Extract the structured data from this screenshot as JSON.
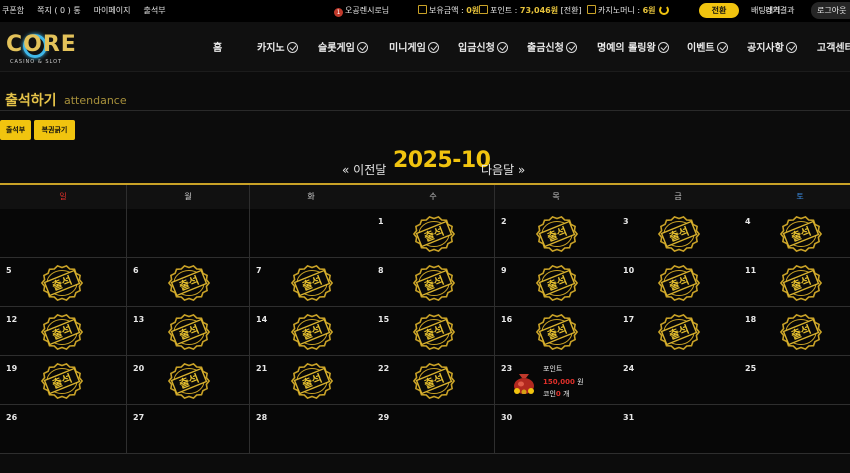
{
  "topbar": {
    "links": [
      "쿠폰함",
      "쪽지 ( 0 ) 통",
      "마이페이지",
      "출석부"
    ],
    "user_name": "오공렌시로님",
    "balance_label": "보유금액 :",
    "balance_value": "0원",
    "point_label": "포인트 :",
    "point_value": "73,046원",
    "point_action": "[전환]",
    "coin_label": "카지노머니 :",
    "coin_value": "6원",
    "exchange_label": "전환",
    "betting_history": "배팅내역",
    "match_results": "경기결과",
    "logout_label": "로그아웃"
  },
  "logo": {
    "text": "CORE",
    "subtitle": "CASINO & SLOT"
  },
  "nav": [
    "홈",
    "카지노",
    "슬롯게임",
    "미니게임",
    "입금신청",
    "출금신청",
    "명예의 롤링왕",
    "이벤트",
    "공지사항",
    "고객센터"
  ],
  "page": {
    "title": "출석하기",
    "subtitle": "attendance",
    "buttons": [
      "출석부",
      "복권긁기"
    ]
  },
  "month_nav": {
    "prev": "« 이전달",
    "current": "2025-10",
    "next": "다음달 »"
  },
  "calendar": {
    "weekdays": [
      "일",
      "월",
      "화",
      "수",
      "목",
      "금",
      "토"
    ],
    "weekday_colors": {
      "sunday": "#e0302a",
      "saturday": "#3a8ee6",
      "default": "#cfcfcf"
    },
    "stamp_text": "출석",
    "weeks": [
      [
        null,
        null,
        null,
        {
          "day": "1",
          "attended": true
        },
        {
          "day": "2",
          "attended": true
        },
        {
          "day": "3",
          "attended": true
        },
        {
          "day": "4",
          "attended": true
        }
      ],
      [
        {
          "day": "5",
          "attended": true
        },
        {
          "day": "6",
          "attended": true
        },
        {
          "day": "7",
          "attended": true
        },
        {
          "day": "8",
          "attended": true
        },
        {
          "day": "9",
          "attended": true
        },
        {
          "day": "10",
          "attended": true
        },
        {
          "day": "11",
          "attended": true
        }
      ],
      [
        {
          "day": "12",
          "attended": true
        },
        {
          "day": "13",
          "attended": true
        },
        {
          "day": "14",
          "attended": true
        },
        {
          "day": "15",
          "attended": true
        },
        {
          "day": "16",
          "attended": true
        },
        {
          "day": "17",
          "attended": true
        },
        {
          "day": "18",
          "attended": true
        }
      ],
      [
        {
          "day": "19",
          "attended": true
        },
        {
          "day": "20",
          "attended": true
        },
        {
          "day": "21",
          "attended": true
        },
        {
          "day": "22",
          "attended": true
        },
        {
          "day": "23",
          "attended": false,
          "reward": true
        },
        {
          "day": "24",
          "attended": false
        },
        {
          "day": "25",
          "attended": false
        }
      ],
      [
        {
          "day": "26",
          "attended": false
        },
        {
          "day": "27",
          "attended": false
        },
        {
          "day": "28",
          "attended": false
        },
        {
          "day": "29",
          "attended": false
        },
        {
          "day": "30",
          "attended": false
        },
        {
          "day": "31",
          "attended": false
        },
        null
      ]
    ],
    "reward": {
      "line1": "포인트",
      "amount": "150,000",
      "amount_unit": " 원",
      "coin_label": "코인",
      "coin_count": "0",
      "coin_unit": " 개"
    }
  }
}
